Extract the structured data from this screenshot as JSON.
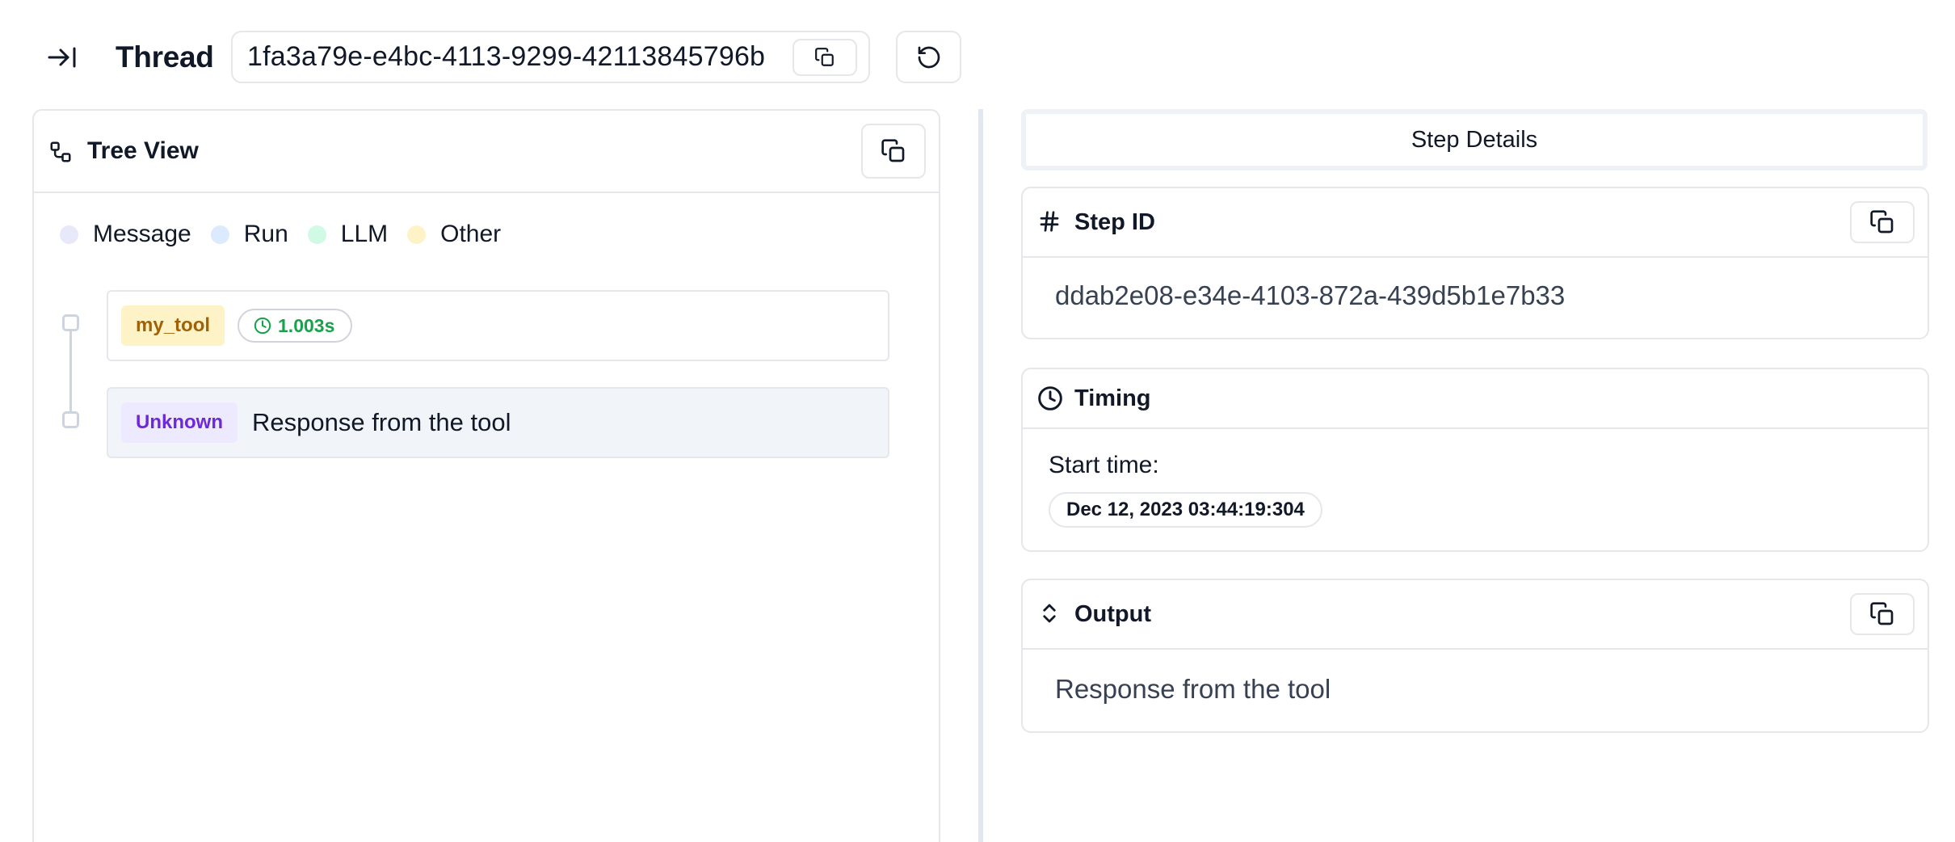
{
  "header": {
    "title": "Thread",
    "thread_id": "1fa3a79e-e4bc-4113-9299-42113845796b"
  },
  "tree_view": {
    "title": "Tree View",
    "legend": [
      {
        "label": "Message",
        "color": "#e8e8fb"
      },
      {
        "label": "Run",
        "color": "#dbeafe"
      },
      {
        "label": "LLM",
        "color": "#d1fae5"
      },
      {
        "label": "Other",
        "color": "#fef3c7"
      }
    ],
    "steps": [
      {
        "tag": "my_tool",
        "duration": "1.003s"
      },
      {
        "tag": "Unknown",
        "text": "Response from the tool"
      }
    ]
  },
  "details": {
    "tab_label": "Step Details",
    "step_id": {
      "title": "Step ID",
      "value": "ddab2e08-e34e-4103-872a-439d5b1e7b33"
    },
    "timing": {
      "title": "Timing",
      "start_label": "Start time:",
      "start_value": "Dec 12, 2023 03:44:19:304"
    },
    "output": {
      "title": "Output",
      "value": "Response from the tool"
    }
  },
  "icons": {
    "collapse": "arrow-right-to-line-icon",
    "copy": "copy-icon",
    "refresh": "rotate-ccw-icon",
    "tree": "workflow-icon",
    "hash": "hash-icon",
    "clock": "clock-icon",
    "expand": "chevrons-up-down-icon"
  },
  "colors": {
    "border": "#e5e7eb",
    "tool_tag_bg": "#fef3c7",
    "tool_tag_text": "#a16207",
    "unknown_tag_bg": "#ede9fe",
    "unknown_tag_text": "#6d28d9",
    "duration_text": "#16a34a",
    "selected_row_bg": "#f1f5f9"
  }
}
